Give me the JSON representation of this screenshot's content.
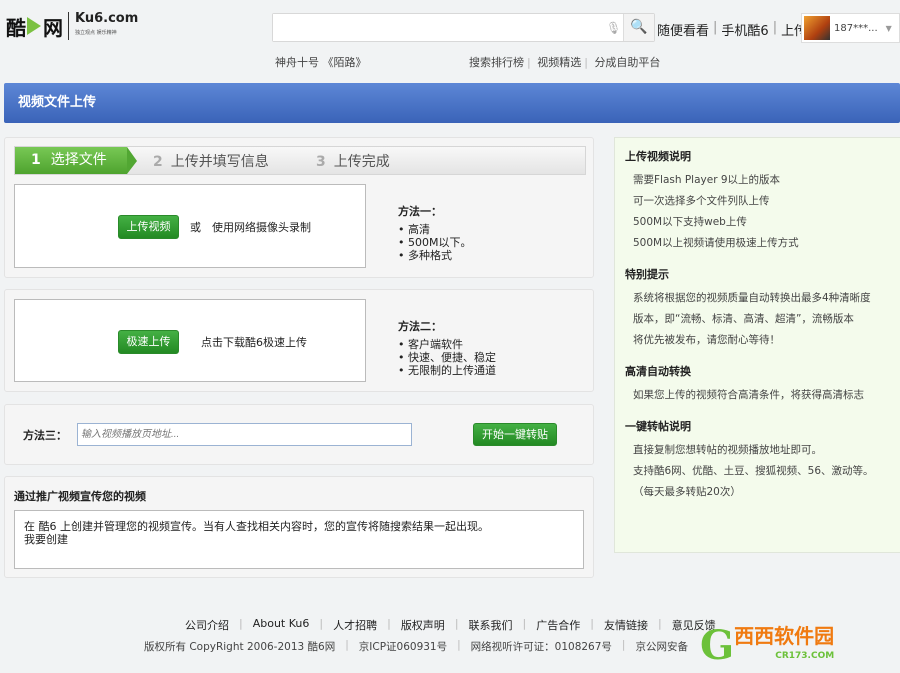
{
  "header": {
    "logo_cn": "酷6网",
    "logo_en": "Ku6.com",
    "logo_tagline": "独立观点 娱乐精神",
    "search_placeholder": "",
    "nav": [
      "随便看看",
      "手机酷6",
      "上传"
    ],
    "username": "187***...",
    "hot": "神舟十号 《陌路》",
    "links": [
      "搜索排行榜",
      "视频精选",
      "分成自助平台"
    ]
  },
  "page": {
    "title": "视频文件上传"
  },
  "steps": [
    {
      "num": "1",
      "label": "选择文件",
      "active": true
    },
    {
      "num": "2",
      "label": "上传并填写信息"
    },
    {
      "num": "3",
      "label": "上传完成"
    }
  ],
  "method1": {
    "button": "上传视频",
    "or": "或",
    "alt": "使用网络摄像头录制",
    "title": "方法一：",
    "points": [
      "高清",
      "500M以下。",
      "多种格式"
    ]
  },
  "method2": {
    "button": "极速上传",
    "desc": "点击下载酷6极速上传",
    "title": "方法二：",
    "points": [
      "客户端软件",
      "快速、便捷、稳定",
      "无限制的上传通道"
    ]
  },
  "method3": {
    "label": "方法三：",
    "placeholder": "输入视频播放页地址...",
    "button": "开始一键转贴"
  },
  "promo": {
    "title": "通过推广视频宣传您的视频",
    "text": "在 酷6 上创建并管理您的视频宣传。当有人查找相关内容时，您的宣传将随搜索结果一起出现。",
    "link": "我要创建"
  },
  "sidebar": [
    {
      "title": "上传视频说明",
      "lines": [
        "需要Flash Player 9以上的版本",
        "可一次选择多个文件列队上传",
        "500M以下支持web上传",
        "500M以上视频请使用极速上传方式"
      ]
    },
    {
      "title": "特别提示",
      "lines": [
        "系统将根据您的视频质量自动转换出最多4种清晰度",
        "版本，即“流畅、标清、高清、超清”，流畅版本",
        "将优先被发布，请您耐心等待！"
      ]
    },
    {
      "title": "高清自动转换",
      "lines": [
        "如果您上传的视频符合高清条件，将获得高清标志"
      ]
    },
    {
      "title": "一键转帖说明",
      "lines": [
        "直接复制您想转帖的视频播放地址即可。",
        "支持酷6网、优酷、土豆、搜狐视频、56、激动等。",
        "（每天最多转贴20次）"
      ]
    }
  ],
  "footer": {
    "links": [
      "公司介绍",
      "About Ku6",
      "人才招聘",
      "版权声明",
      "联系我们",
      "广告合作",
      "友情链接",
      "意见反馈"
    ],
    "copyright": [
      "版权所有 CopyRight 2006-2013 酷6网",
      "京ICP证060931号",
      "网络视听许可证：0108267号",
      "京公网安备"
    ]
  },
  "watermark": {
    "text": "西西软件园",
    "domain": "CR173.COM"
  }
}
